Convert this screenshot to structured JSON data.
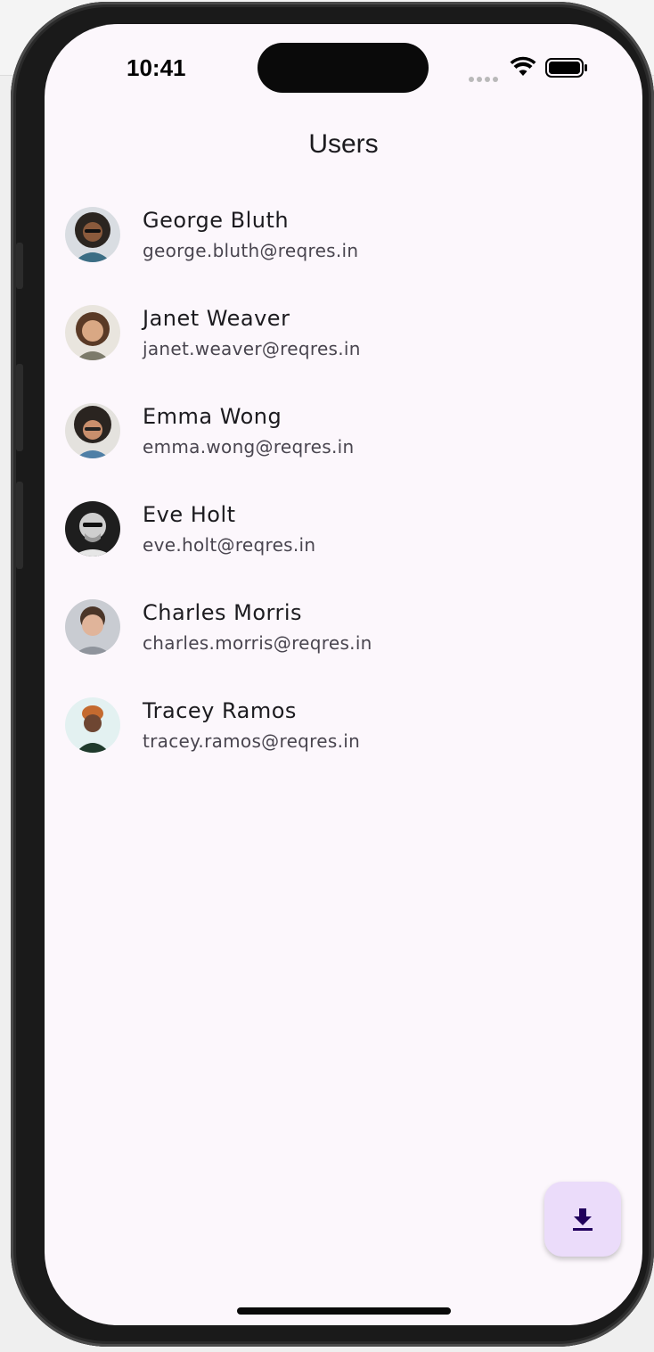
{
  "status_bar": {
    "time": "10:41"
  },
  "app_bar": {
    "title": "Users"
  },
  "users": [
    {
      "name": "George Bluth",
      "email": "george.bluth@reqres.in"
    },
    {
      "name": "Janet Weaver",
      "email": "janet.weaver@reqres.in"
    },
    {
      "name": "Emma Wong",
      "email": "emma.wong@reqres.in"
    },
    {
      "name": "Eve Holt",
      "email": "eve.holt@reqres.in"
    },
    {
      "name": "Charles Morris",
      "email": "charles.morris@reqres.in"
    },
    {
      "name": "Tracey Ramos",
      "email": "tracey.ramos@reqres.in"
    }
  ],
  "fab": {
    "icon": "download-icon",
    "background": "#ebdcfa",
    "icon_color": "#21005d"
  },
  "colors": {
    "screen_background": "#fcf7fc",
    "primary_text": "#1c1b1f",
    "secondary_text": "#49454f"
  }
}
